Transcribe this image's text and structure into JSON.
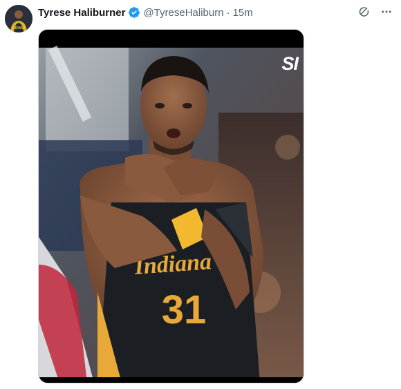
{
  "tweet": {
    "author_name": "Tyrese Haliburner",
    "handle": "@TyreseHaliburn",
    "separator": "·",
    "timestamp": "15m",
    "verified": true,
    "avatar_icon": "profile-avatar",
    "actions": {
      "grok_icon": "grok-icon",
      "more_icon": "more-dots-icon"
    },
    "media": {
      "logo_text": "SI",
      "jersey_text": "Indiana",
      "jersey_number": "31",
      "colors": {
        "jersey": "#1b1f24",
        "trim": "#e8a93a",
        "wristband": "#f2b830",
        "skin": "#8a5a3e"
      }
    }
  },
  "colors": {
    "verified_blue": "#1d9bf0",
    "muted_text": "#536471",
    "text": "#0f1419"
  }
}
